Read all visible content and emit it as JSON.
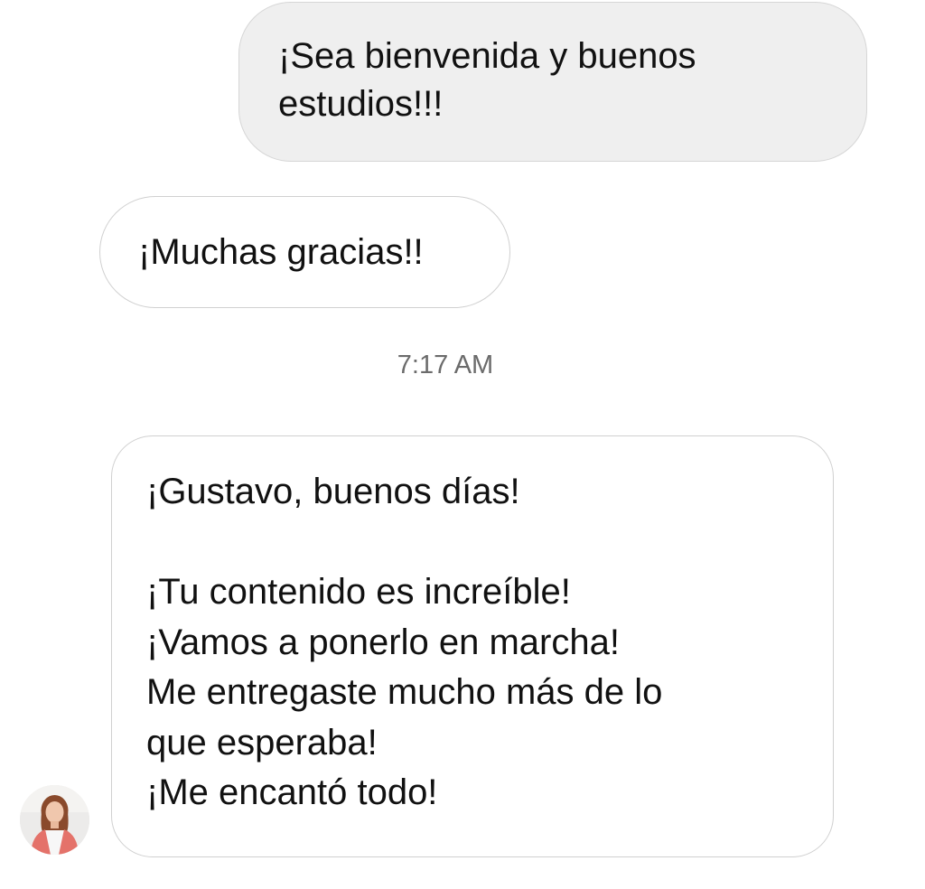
{
  "messages": {
    "sent_1": "¡Sea bienvenida y buenos\nestudios!!!",
    "received_1": "¡Muchas gracias!!",
    "timestamp": "7:17 AM",
    "received_2": "¡Gustavo, buenos días!\n\n¡Tu contenido es increíble!\n¡Vamos a ponerlo en marcha!\nMe entregaste mucho más de lo\nque esperaba!\n¡Me encantó todo!"
  },
  "avatar": {
    "icon": "user-avatar-photo"
  },
  "colors": {
    "sent_bubble": "#efefef",
    "received_bubble": "#ffffff",
    "bubble_border": "#d0d0d0",
    "timestamp_text": "#6b6b6b"
  }
}
